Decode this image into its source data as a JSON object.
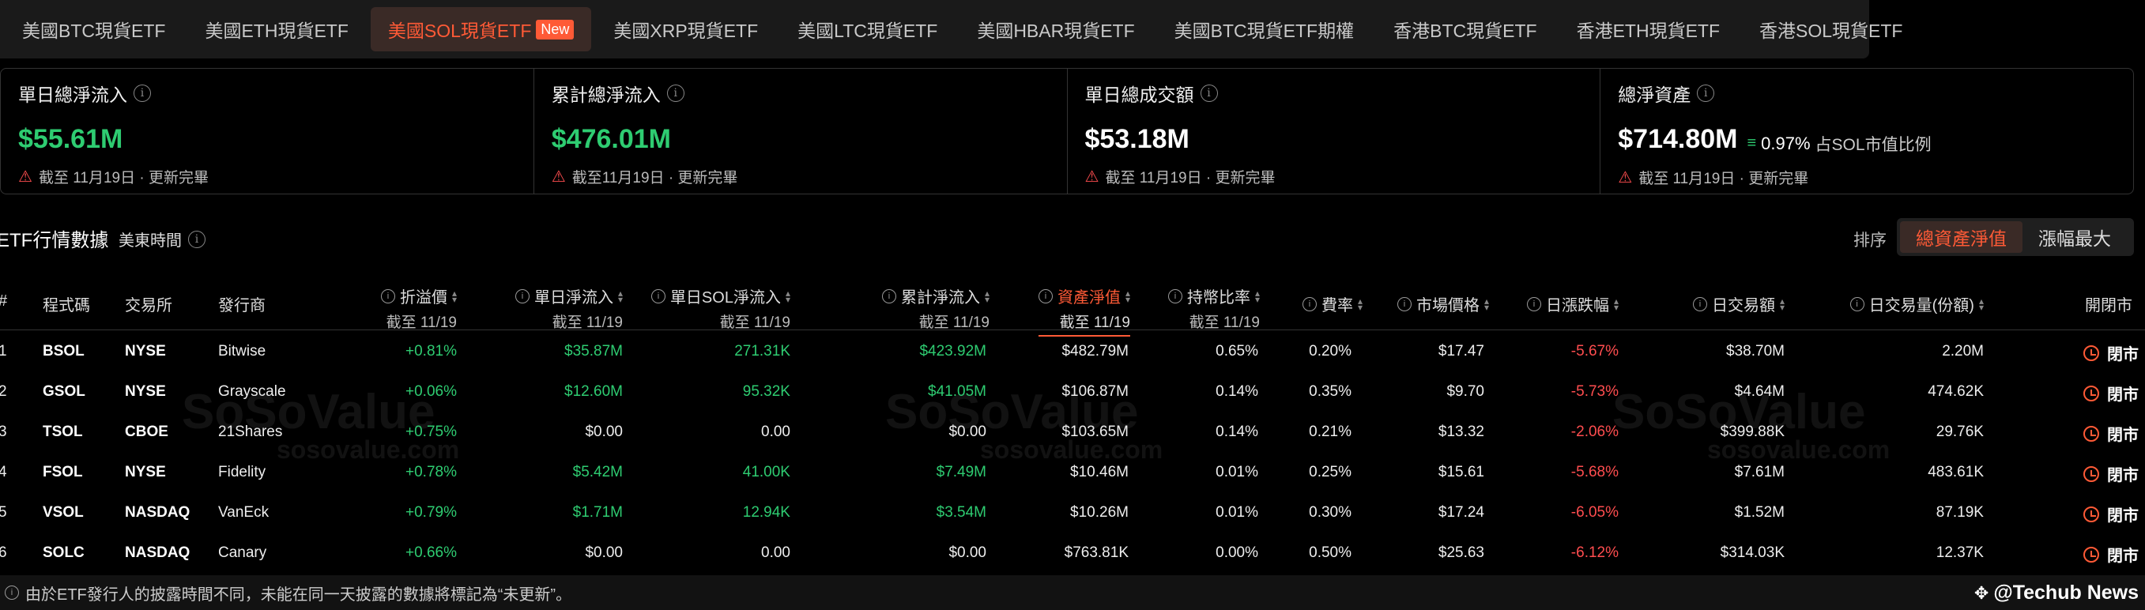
{
  "tabs": [
    {
      "label": "美國BTC現貨ETF",
      "active": false
    },
    {
      "label": "美國ETH現貨ETF",
      "active": false
    },
    {
      "label": "美國SOL現貨ETF",
      "active": true,
      "badge": "New"
    },
    {
      "label": "美國XRP現貨ETF",
      "active": false
    },
    {
      "label": "美國LTC現貨ETF",
      "active": false
    },
    {
      "label": "美國HBAR現貨ETF",
      "active": false
    },
    {
      "label": "美國BTC現貨ETF期權",
      "active": false
    },
    {
      "label": "香港BTC現貨ETF",
      "active": false
    },
    {
      "label": "香港ETH現貨ETF",
      "active": false
    },
    {
      "label": "香港SOL現貨ETF",
      "active": false
    }
  ],
  "stats": [
    {
      "label": "單日總淨流入",
      "value": "$55.61M",
      "note": "截至 11月19日 · 更新完畢"
    },
    {
      "label": "累計總淨流入",
      "value": "$476.01M",
      "note": "截至11月19日 · 更新完畢"
    },
    {
      "label": "單日總成交額",
      "value": "$53.18M",
      "note": "截至 11月19日 · 更新完畢"
    },
    {
      "label": "總淨資產",
      "value": "$714.80M",
      "sub_pct": "0.97%",
      "sub_label": "占SOL市值比例",
      "note": "截至 11月19日 · 更新完畢"
    }
  ],
  "section": {
    "title": "ETF行情數據",
    "time": "美東時間",
    "sort_label": "排序",
    "sort_options": [
      "總資產淨值",
      "漲幅最大"
    ]
  },
  "columns": {
    "num": "#",
    "code": "程式碼",
    "exchange": "交易所",
    "issuer": "發行商",
    "premium": "折溢價",
    "daily_flow": "單日淨流入",
    "daily_sol": "單日SOL淨流入",
    "cum_flow": "累計淨流入",
    "nav": "資產淨值",
    "hold_ratio": "持幣比率",
    "fee": "費率",
    "price": "市場價格",
    "change": "日漲跌幅",
    "volume_usd": "日交易額",
    "volume_shares": "日交易量(份額)",
    "market": "開閉市",
    "asof": "截至 11/19"
  },
  "rows": [
    {
      "num": "1",
      "code": "BSOL",
      "exchange": "NYSE",
      "issuer": "Bitwise",
      "premium": "+0.81%",
      "daily_flow": "$35.87M",
      "daily_sol": "271.31K",
      "cum_flow": "$423.92M",
      "nav": "$482.79M",
      "hold_ratio": "0.65%",
      "fee": "0.20%",
      "price": "$17.47",
      "change": "-5.67%",
      "volume_usd": "$38.70M",
      "volume_shares": "2.20M",
      "market": "閉市"
    },
    {
      "num": "2",
      "code": "GSOL",
      "exchange": "NYSE",
      "issuer": "Grayscale",
      "premium": "+0.06%",
      "daily_flow": "$12.60M",
      "daily_sol": "95.32K",
      "cum_flow": "$41.05M",
      "nav": "$106.87M",
      "hold_ratio": "0.14%",
      "fee": "0.35%",
      "price": "$9.70",
      "change": "-5.73%",
      "volume_usd": "$4.64M",
      "volume_shares": "474.62K",
      "market": "閉市"
    },
    {
      "num": "3",
      "code": "TSOL",
      "exchange": "CBOE",
      "issuer": "21Shares",
      "premium": "+0.75%",
      "daily_flow": "$0.00",
      "daily_sol": "0.00",
      "cum_flow": "$0.00",
      "nav": "$103.65M",
      "hold_ratio": "0.14%",
      "fee": "0.21%",
      "price": "$13.32",
      "change": "-2.06%",
      "volume_usd": "$399.88K",
      "volume_shares": "29.76K",
      "market": "閉市"
    },
    {
      "num": "4",
      "code": "FSOL",
      "exchange": "NYSE",
      "issuer": "Fidelity",
      "premium": "+0.78%",
      "daily_flow": "$5.42M",
      "daily_sol": "41.00K",
      "cum_flow": "$7.49M",
      "nav": "$10.46M",
      "hold_ratio": "0.01%",
      "fee": "0.25%",
      "price": "$15.61",
      "change": "-5.68%",
      "volume_usd": "$7.61M",
      "volume_shares": "483.61K",
      "market": "閉市"
    },
    {
      "num": "5",
      "code": "VSOL",
      "exchange": "NASDAQ",
      "issuer": "VanEck",
      "premium": "+0.79%",
      "daily_flow": "$1.71M",
      "daily_sol": "12.94K",
      "cum_flow": "$3.54M",
      "nav": "$10.26M",
      "hold_ratio": "0.01%",
      "fee": "0.30%",
      "price": "$17.24",
      "change": "-6.05%",
      "volume_usd": "$1.52M",
      "volume_shares": "87.19K",
      "market": "閉市"
    },
    {
      "num": "6",
      "code": "SOLC",
      "exchange": "NASDAQ",
      "issuer": "Canary",
      "premium": "+0.66%",
      "daily_flow": "$0.00",
      "daily_sol": "0.00",
      "cum_flow": "$0.00",
      "nav": "$763.81K",
      "hold_ratio": "0.00%",
      "fee": "0.50%",
      "price": "$25.63",
      "change": "-6.12%",
      "volume_usd": "$314.03K",
      "volume_shares": "12.37K",
      "market": "閉市"
    }
  ],
  "watermark": {
    "brand": "SoSoValue",
    "domain": "sosovalue.com"
  },
  "footer": {
    "note": "由於ETF發行人的披露時間不同，未能在同一天披露的數據將標記為“未更新”。",
    "brand": "@Techub News"
  },
  "colors": {
    "accent": "#ff5a36",
    "positive": "#2ecc71",
    "negative": "#ff4d4f",
    "background": "#000000"
  }
}
